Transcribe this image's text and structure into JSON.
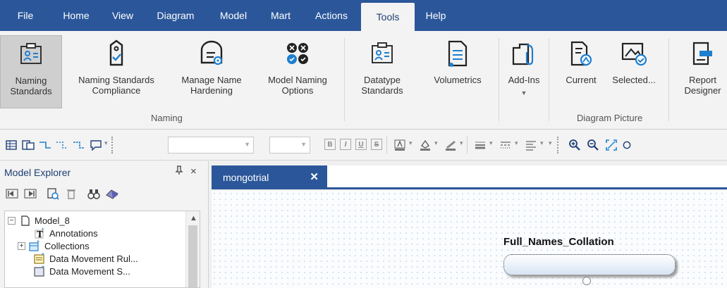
{
  "menu": {
    "items": [
      "File",
      "Home",
      "View",
      "Diagram",
      "Model",
      "Mart",
      "Actions",
      "Tools",
      "Help"
    ],
    "active": "Tools"
  },
  "ribbon": {
    "buttons": {
      "naming_standards": "Naming\nStandards",
      "ns_compliance": "Naming Standards\nCompliance",
      "manage_name_hardening": "Manage Name\nHardening",
      "model_naming_options": "Model Naming\nOptions",
      "datatype_standards": "Datatype\nStandards",
      "volumetrics": "Volumetrics",
      "add_ins": "Add-Ins",
      "current": "Current",
      "selected": "Selected...",
      "report_designer": "Report\nDesigner"
    },
    "groups": {
      "naming": "Naming",
      "diagram_picture": "Diagram Picture"
    }
  },
  "toolbar": {
    "format_buttons": [
      "B",
      "I",
      "U",
      "S"
    ]
  },
  "explorer": {
    "title": "Model Explorer",
    "pin": "ᵽ",
    "close": "×",
    "tree": [
      {
        "label": "Model_8",
        "expander": "−"
      },
      {
        "label": "Annotations"
      },
      {
        "label": "Collections",
        "expander": "+"
      },
      {
        "label": "Data Movement Rul..."
      },
      {
        "label": "Data Movement S..."
      }
    ]
  },
  "document": {
    "tab_label": "mongotrial",
    "tab_close": "✕",
    "entity_name": "Full_Names_Collation"
  },
  "colors": {
    "accent": "#2b579a",
    "ribbon_bg": "#f3f3f3",
    "icon_blue": "#1e7fd0"
  }
}
